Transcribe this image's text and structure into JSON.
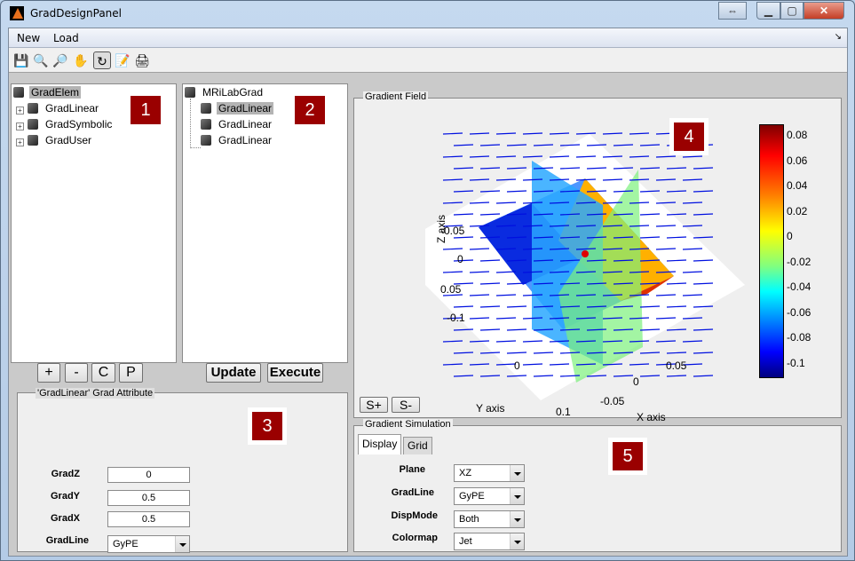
{
  "window": {
    "title": "GradDesignPanel",
    "controls": [
      "restore-arrows",
      "minimize",
      "maximize",
      "close"
    ]
  },
  "menu": {
    "items": [
      "New",
      "Load"
    ]
  },
  "toolbar": {
    "icons": [
      "save-icon",
      "zoom-in-icon",
      "zoom-out-icon",
      "pan-icon",
      "rotate-3d-icon",
      "data-cursor-icon",
      "print-icon"
    ],
    "active": "rotate-3d-icon"
  },
  "tree1": {
    "root": "GradElem",
    "children": [
      "GradLinear",
      "GradSymbolic",
      "GradUser"
    ]
  },
  "tree2": {
    "root": "MRiLabGrad",
    "children": [
      "GradLinear",
      "GradLinear",
      "GradLinear"
    ],
    "selected_index": 0
  },
  "badges": [
    "1",
    "2",
    "3",
    "4",
    "5"
  ],
  "tree_buttons": [
    "+",
    "-",
    "C",
    "P"
  ],
  "action_buttons": {
    "update": "Update",
    "execute": "Execute"
  },
  "attributes": {
    "title": "'GradLinear' Grad Attribute",
    "fields": [
      {
        "label": "GradZ",
        "value": "0"
      },
      {
        "label": "GradY",
        "value": "0.5"
      },
      {
        "label": "GradX",
        "value": "0.5"
      }
    ],
    "gradline": {
      "label": "GradLine",
      "value": "GyPE"
    }
  },
  "gradient_field": {
    "title": "Gradient Field",
    "scale_buttons": [
      "S+",
      "S-"
    ],
    "z_axis": {
      "label": "Z axis",
      "ticks": [
        "-0.05",
        "0",
        "0.05",
        "-0.1"
      ]
    },
    "y_axis": {
      "label": "Y axis",
      "ticks": [
        "0",
        "0.1"
      ]
    },
    "x_axis": {
      "label": "X axis",
      "ticks": [
        "0.05",
        "0",
        "-0.05"
      ]
    },
    "colorbar_ticks": [
      "0.08",
      "0.06",
      "0.04",
      "0.02",
      "0",
      "-0.02",
      "-0.04",
      "-0.06",
      "-0.08",
      "-0.1"
    ],
    "colormap": "Jet"
  },
  "simulation": {
    "title": "Gradient Simulation",
    "tabs": [
      "Display",
      "Grid"
    ],
    "active_tab": "Display",
    "rows": [
      {
        "label": "Plane",
        "value": "XZ"
      },
      {
        "label": "GradLine",
        "value": "GyPE"
      },
      {
        "label": "DispMode",
        "value": "Both"
      },
      {
        "label": "Colormap",
        "value": "Jet"
      }
    ]
  }
}
